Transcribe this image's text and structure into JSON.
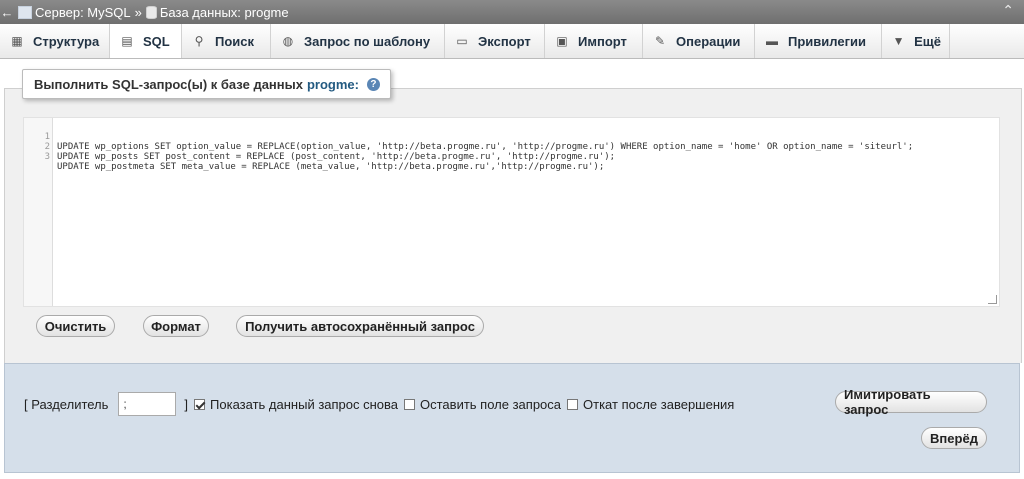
{
  "breadcrumb": {
    "back_arrow": "←",
    "server": "Сервер: MySQL",
    "separator": "»",
    "database": "База данных: progme",
    "collapse": "⌃"
  },
  "tabs": [
    {
      "label": "Структура",
      "icon": "structure-icon",
      "active": false
    },
    {
      "label": "SQL",
      "icon": "sql-icon",
      "active": true
    },
    {
      "label": "Поиск",
      "icon": "search-icon",
      "active": false
    },
    {
      "label": "Запрос по шаблону",
      "icon": "query-icon",
      "active": false
    },
    {
      "label": "Экспорт",
      "icon": "export-icon",
      "active": false
    },
    {
      "label": "Импорт",
      "icon": "import-icon",
      "active": false
    },
    {
      "label": "Операции",
      "icon": "wrench-icon",
      "active": false
    },
    {
      "label": "Привилегии",
      "icon": "privileges-icon",
      "active": false
    },
    {
      "label": "Ещё",
      "icon": "chevron-down-icon",
      "active": false
    }
  ],
  "query": {
    "title": "Выполнить SQL-запрос(ы) к базе данных",
    "database": "progme:",
    "help_icon": "?",
    "lines": [
      {
        "n": "1",
        "text": "UPDATE wp_options SET option_value = REPLACE(option_value, 'http://beta.progme.ru', 'http://progme.ru') WHERE option_name = 'home' OR option_name = 'siteurl';"
      },
      {
        "n": "2",
        "text": "UPDATE wp_posts SET post_content = REPLACE (post_content, 'http://beta.progme.ru', 'http://progme.ru');"
      },
      {
        "n": "3",
        "text": "UPDATE wp_postmeta SET meta_value = REPLACE (meta_value, 'http://beta.progme.ru','http://progme.ru');"
      }
    ],
    "buttons": {
      "clear": "Очистить",
      "format": "Формат",
      "autosaved": "Получить автосохранённый запрос"
    }
  },
  "options": {
    "delimiter_label_open": "[ Разделитель",
    "delimiter_value": ";",
    "delimiter_label_close": "]",
    "show_query_again": {
      "label": "Показать данный запрос снова",
      "checked": true
    },
    "retain_box": {
      "label": "Оставить поле запроса",
      "checked": false
    },
    "rollback": {
      "label": "Откат после завершения",
      "checked": false
    },
    "simulate_button": "Имитировать запрос",
    "go_button": "Вперёд"
  },
  "colors": {
    "topbar": "#7a7a7a",
    "db_name": "#235a81",
    "options_bg": "#d5dfea"
  }
}
